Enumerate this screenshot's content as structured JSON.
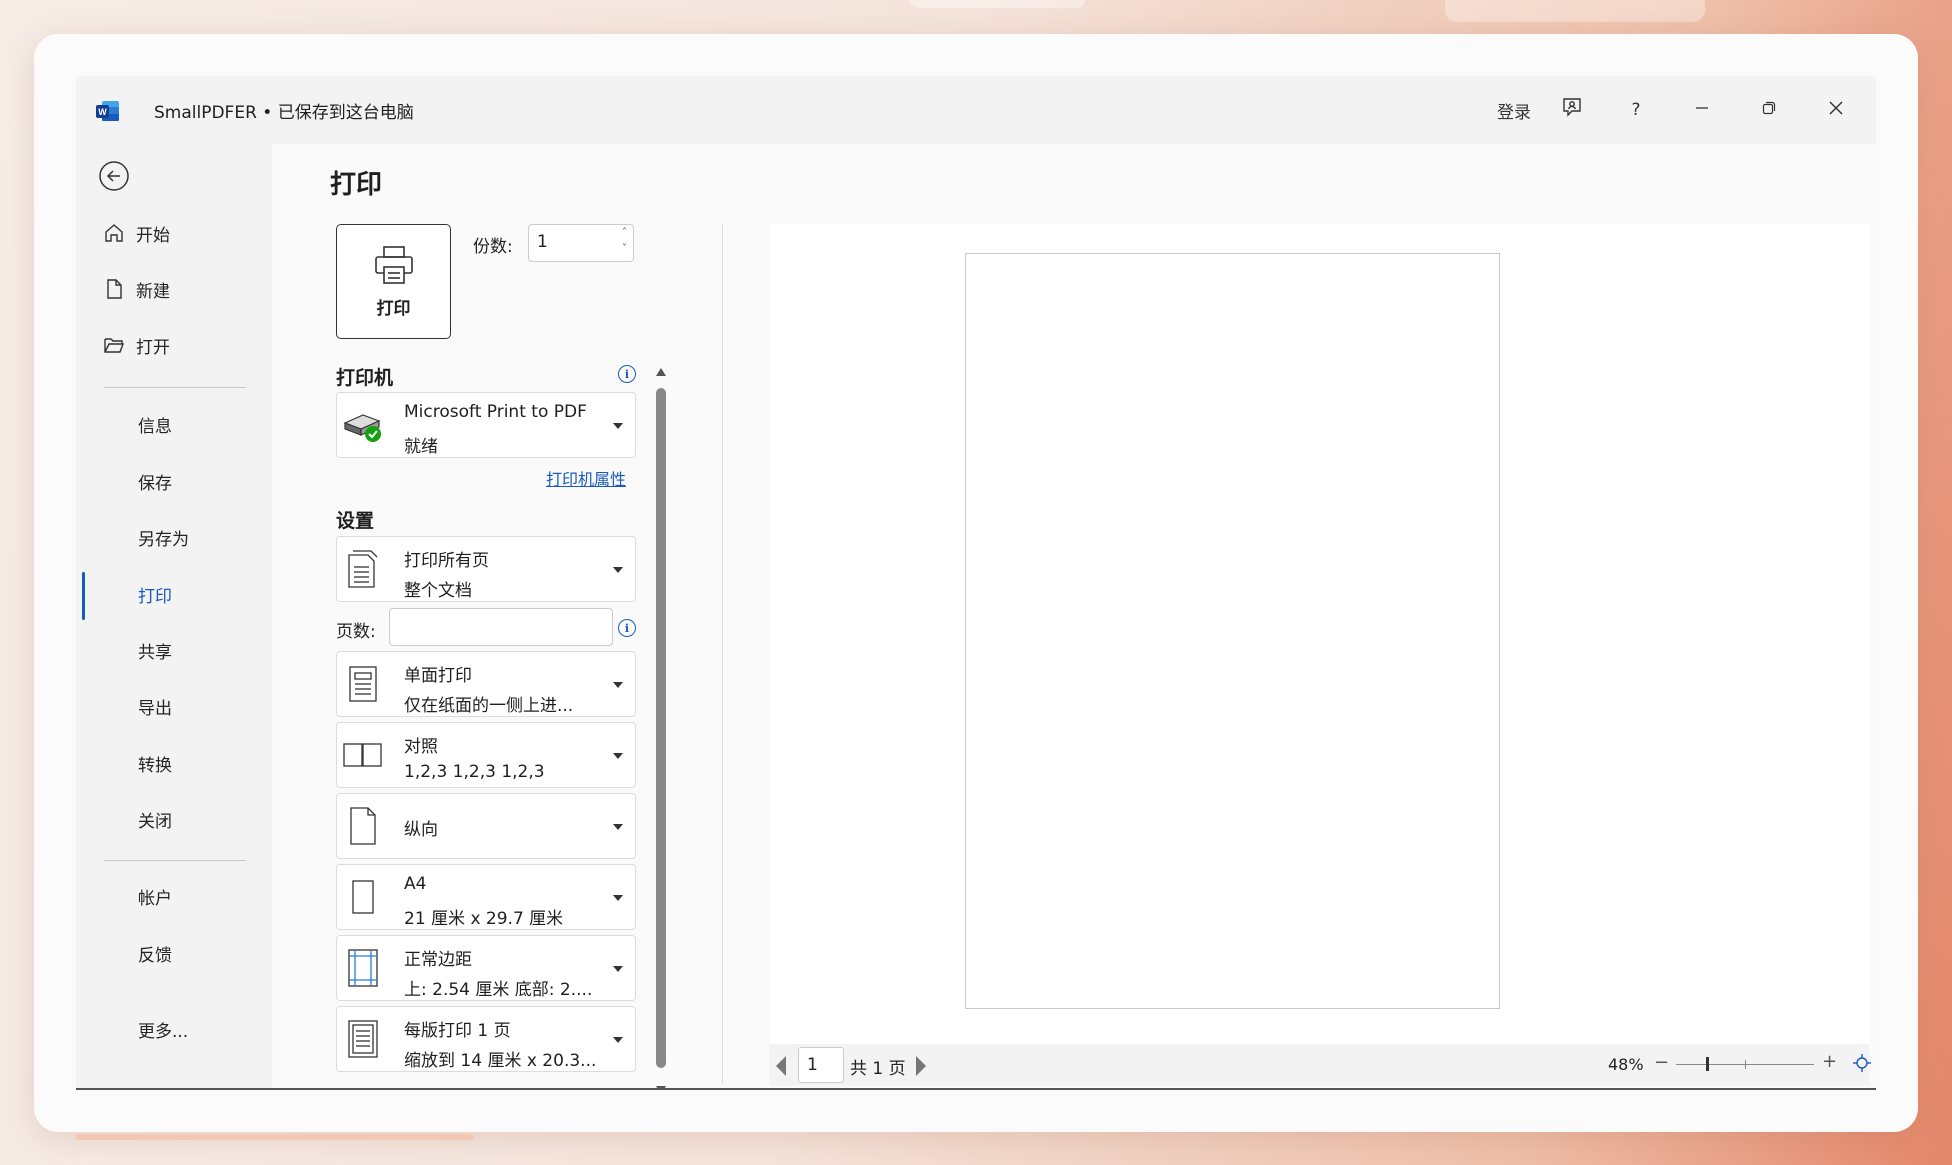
{
  "window": {
    "title": "SmallPDFER • 已保存到这台电脑",
    "signin": "登录",
    "help": "?"
  },
  "sidebar": {
    "items_top": [
      {
        "label": "开始",
        "icon": "home-icon"
      },
      {
        "label": "新建",
        "icon": "new-document-icon"
      },
      {
        "label": "打开",
        "icon": "folder-open-icon"
      }
    ],
    "items_mid": [
      "信息",
      "保存",
      "另存为",
      "打印",
      "共享",
      "导出",
      "转换",
      "关闭"
    ],
    "active": "打印",
    "items_bottom": [
      "帐户",
      "反馈",
      "更多..."
    ]
  },
  "print": {
    "page_title": "打印",
    "print_button_label": "打印",
    "copies_label": "份数:",
    "copies_value": "1",
    "printer_section": "打印机",
    "printer_name": "Microsoft Print to PDF",
    "printer_status": "就绪",
    "printer_properties": "打印机属性",
    "settings_section": "设置",
    "pages_label": "页数:",
    "pages_value": "",
    "settings": [
      {
        "line1": "打印所有页",
        "line2": "整个文档",
        "icon": "pages-icon"
      },
      {
        "line1": "单面打印",
        "line2": "仅在纸面的一侧上进...",
        "icon": "one-sided-icon"
      },
      {
        "line1": "对照",
        "line2": "1,2,3     1,2,3     1,2,3",
        "icon": "collated-icon"
      },
      {
        "line1": "纵向",
        "line2": "",
        "icon": "portrait-icon"
      },
      {
        "line1": "A4",
        "line2": "21 厘米 x 29.7 厘米",
        "icon": "paper-size-icon"
      },
      {
        "line1": "正常边距",
        "line2": "上: 2.54 厘米 底部: 2....",
        "icon": "margins-icon"
      },
      {
        "line1": "每版打印 1 页",
        "line2": "缩放到 14 厘米 x 20.3...",
        "icon": "pages-per-sheet-icon"
      }
    ]
  },
  "preview": {
    "current_page": "1",
    "total_pages": "共 1 页",
    "zoom": "48%"
  },
  "colors": {
    "accent": "#185abd",
    "word_blue": "#2b579a",
    "status_green": "#13a10e"
  }
}
